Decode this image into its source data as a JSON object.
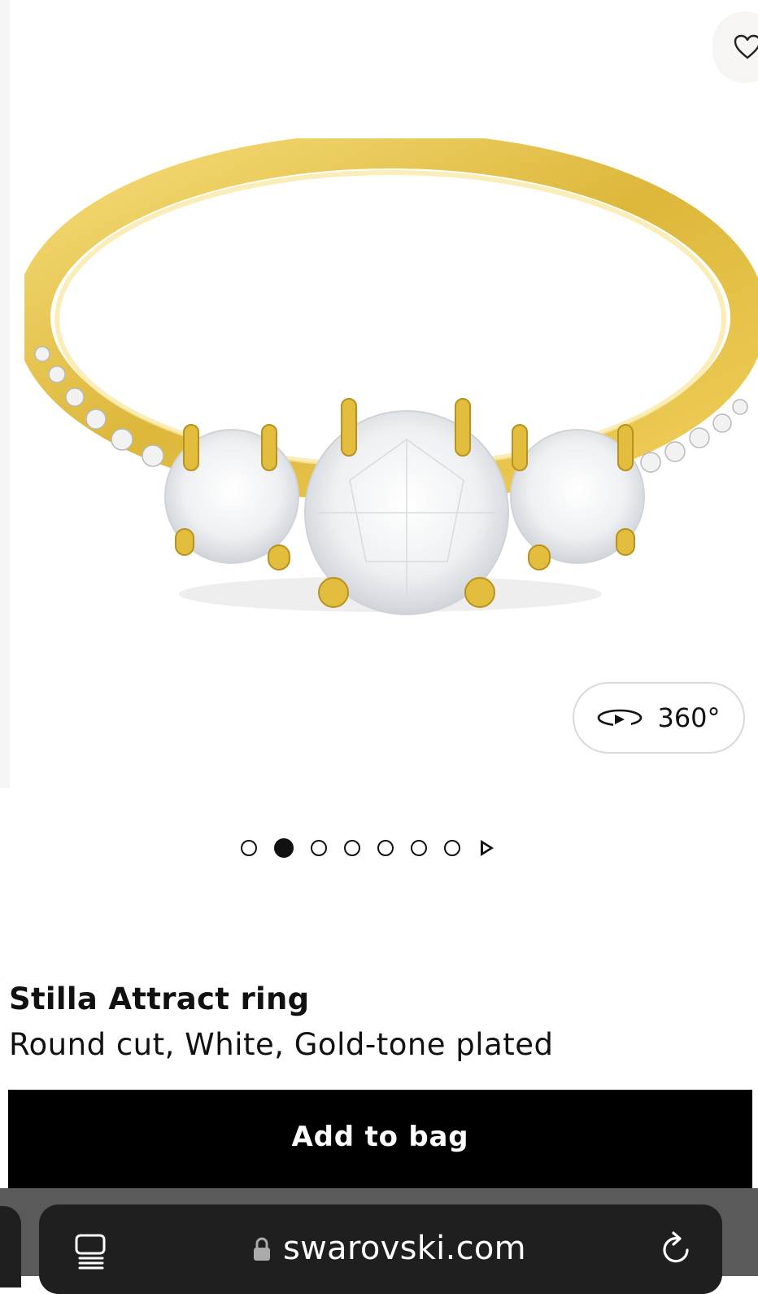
{
  "product": {
    "name": "Stilla Attract ring",
    "description": "Round cut, White, Gold-tone plated",
    "add_to_bag_label": "Add to bag"
  },
  "media": {
    "view_360_label": "360°",
    "image_subject": "gold-tone ring with three round white stones and pavé band",
    "carousel": {
      "total_images": 7,
      "active_index": 1,
      "has_video": true
    }
  },
  "icons": {
    "wishlist": "heart-icon",
    "rotate": "rotate-360-icon",
    "tabs": "tabs-icon",
    "lock": "lock-icon",
    "reload": "reload-icon"
  },
  "browser": {
    "url": "swarovski.com"
  },
  "colors": {
    "button_bg": "#000000",
    "button_text": "#ffffff",
    "ring_gold": "#e6c24a",
    "browser_bar": "#1f1f1f"
  }
}
